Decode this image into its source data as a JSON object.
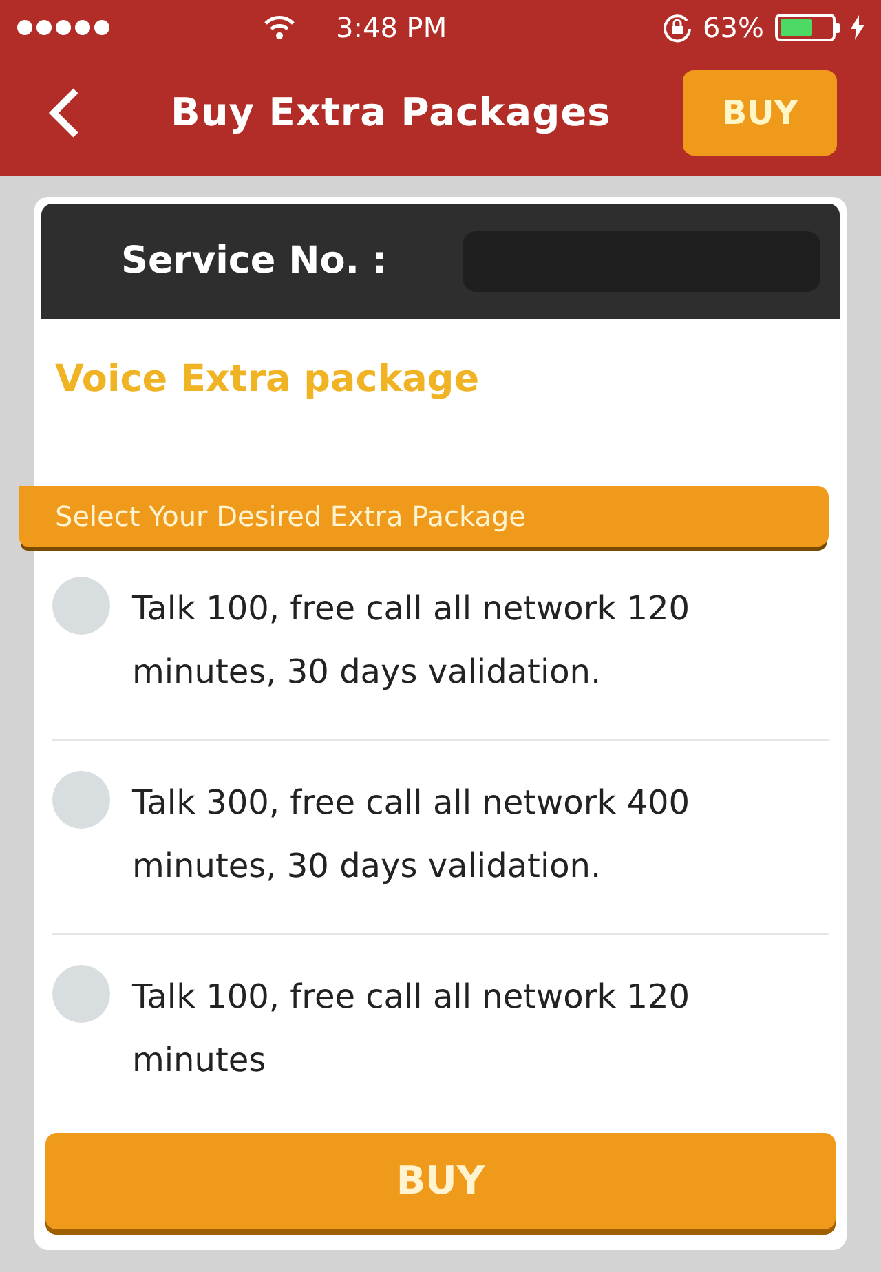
{
  "status_bar": {
    "time": "3:48 PM",
    "battery": "63%"
  },
  "nav": {
    "title": "Buy Extra Packages",
    "button": "BUY"
  },
  "service": {
    "label": "Service No. :"
  },
  "section_title": "Voice Extra package",
  "ribbon": "Select Your Desired Extra Package",
  "options": [
    {
      "label": "Talk 100, free call all network 120 minutes, 30 days validation.",
      "selected": false
    },
    {
      "label": "Talk 300, free call all network 400 minutes, 30 days validation.",
      "selected": false
    },
    {
      "label": "Talk 100, free call all network 120 minutes",
      "selected": false
    }
  ],
  "buy_button": "BUY"
}
